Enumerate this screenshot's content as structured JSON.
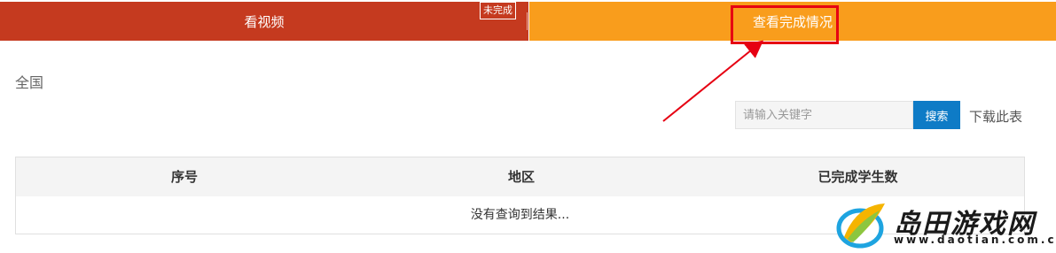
{
  "tabs": {
    "video": {
      "label": "看视频"
    },
    "status": {
      "label": "查看完成情况"
    },
    "badge": "未完成"
  },
  "region": "全国",
  "search": {
    "placeholder": "请输入关键字",
    "button": "搜索",
    "download": "下载此表"
  },
  "table": {
    "headers": [
      "序号",
      "地区",
      "已完成学生数"
    ],
    "empty_text": "没有查询到结果..."
  },
  "watermark": {
    "title": "岛田游戏网",
    "url": "www.daotian.com.cn"
  },
  "colors": {
    "tab_video": "#c53a1f",
    "tab_status": "#f99d1c",
    "search_button": "#0e7bc6",
    "highlight": "#e60012"
  }
}
